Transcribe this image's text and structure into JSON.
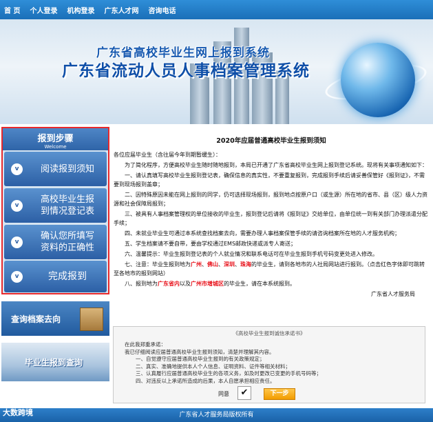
{
  "nav": [
    "首 页",
    "个人登录",
    "机构登录",
    "广东人才网",
    "咨询电话"
  ],
  "banner": {
    "line1": "广东省高校毕业生网上报到系统",
    "line2": "广东省流动人员人事档案管理系统"
  },
  "steps": {
    "header": "报到步骤",
    "header_sub": "Welcome",
    "items": [
      "阅读报到须知",
      "高校毕业生报\n到情况登记表",
      "确认您所填写\n资料的正确性",
      "完成报到"
    ]
  },
  "side": {
    "query_archive": "查询档案去向",
    "query_graduate": "毕业生报到查询"
  },
  "notice": {
    "title": "2020年应届普通高校毕业生报到须知",
    "greeting": "各位应届毕业生（含往届今年到期暂缓生）：",
    "intro": "为了简化程序，方便高校毕业生随时随地报到，本局已开通了广东省高校毕业生网上报到登记系统。现将有关事项通知如下：",
    "p1": "一、请认真填写高校毕业生报到登记表，确保信息的真实性，不要重复报到，完成报到手续后请妥善保管好《报到证》，不需要到现场报到盖章；",
    "p2": "二、因特殊原因未能在网上报到的同学，仍可选择现场报到，报到地点按原户口（或生源）所在地的省市、县（区）级人力资源和社会保障局报到；",
    "p3": "三、被具有人事档案管理权的单位接收的毕业生，报到登记后请将《报到证》交给单位，由单位统一到有关部门办理派遣分配手续；",
    "p4": "四、未就业毕业生可通过本系统查找档案去向，需要办理人事档案保管手续的请咨询档案所在地的人才服务机构；",
    "p5": "五、学生档案请不要自带，要由学校通过EMS邮政快递或派专人寄送；",
    "p6": "六、温馨提示：毕业生报到登记表的个人就业情况和联系电话可在毕业生报到手机号码变更处进入修改。",
    "p7_a": "七、注意：毕业生报到地为",
    "p7_r1": "广州",
    "p7_r2": "佛山",
    "p7_r3": "深圳",
    "p7_r4": "珠海",
    "p7_b": "的毕业生，请到各地市的人社局网站进行报到。（点击红色字体即可跳转至各地市的报到网站）",
    "p8_a": "八、报到地为",
    "p8_r1": "广东省内",
    "p8_b": "以及",
    "p8_r2": "广州市增城区",
    "p8_c": "的毕业生，请在本系统报到。",
    "sign": "广东省人才服务局"
  },
  "commit": {
    "title": "《高校毕业生报到诚信承诺书》",
    "lines": [
      "在此我郑重承诺：",
      "我已仔细阅读应届普通高校毕业生报到须知，清楚并理解其内容。",
      "一、自觉遵守应届普通高校毕业生报到的有关政策规定；",
      "二、真实、准确地提供本人个人信息、证明资料、证件等相关材料；",
      "三、认真履行应届普通高校毕业生的各项义务，如及时更改已变更的手机号码等；",
      "四、对违反以上承诺所造成的后果，本人自愿承担相应责任。"
    ],
    "agree_label": "同意",
    "agree_check": "✔",
    "next_label": "下一步"
  },
  "footer": {
    "text": "广东省人才服务局版权所有",
    "watermark": "大数跨境"
  }
}
